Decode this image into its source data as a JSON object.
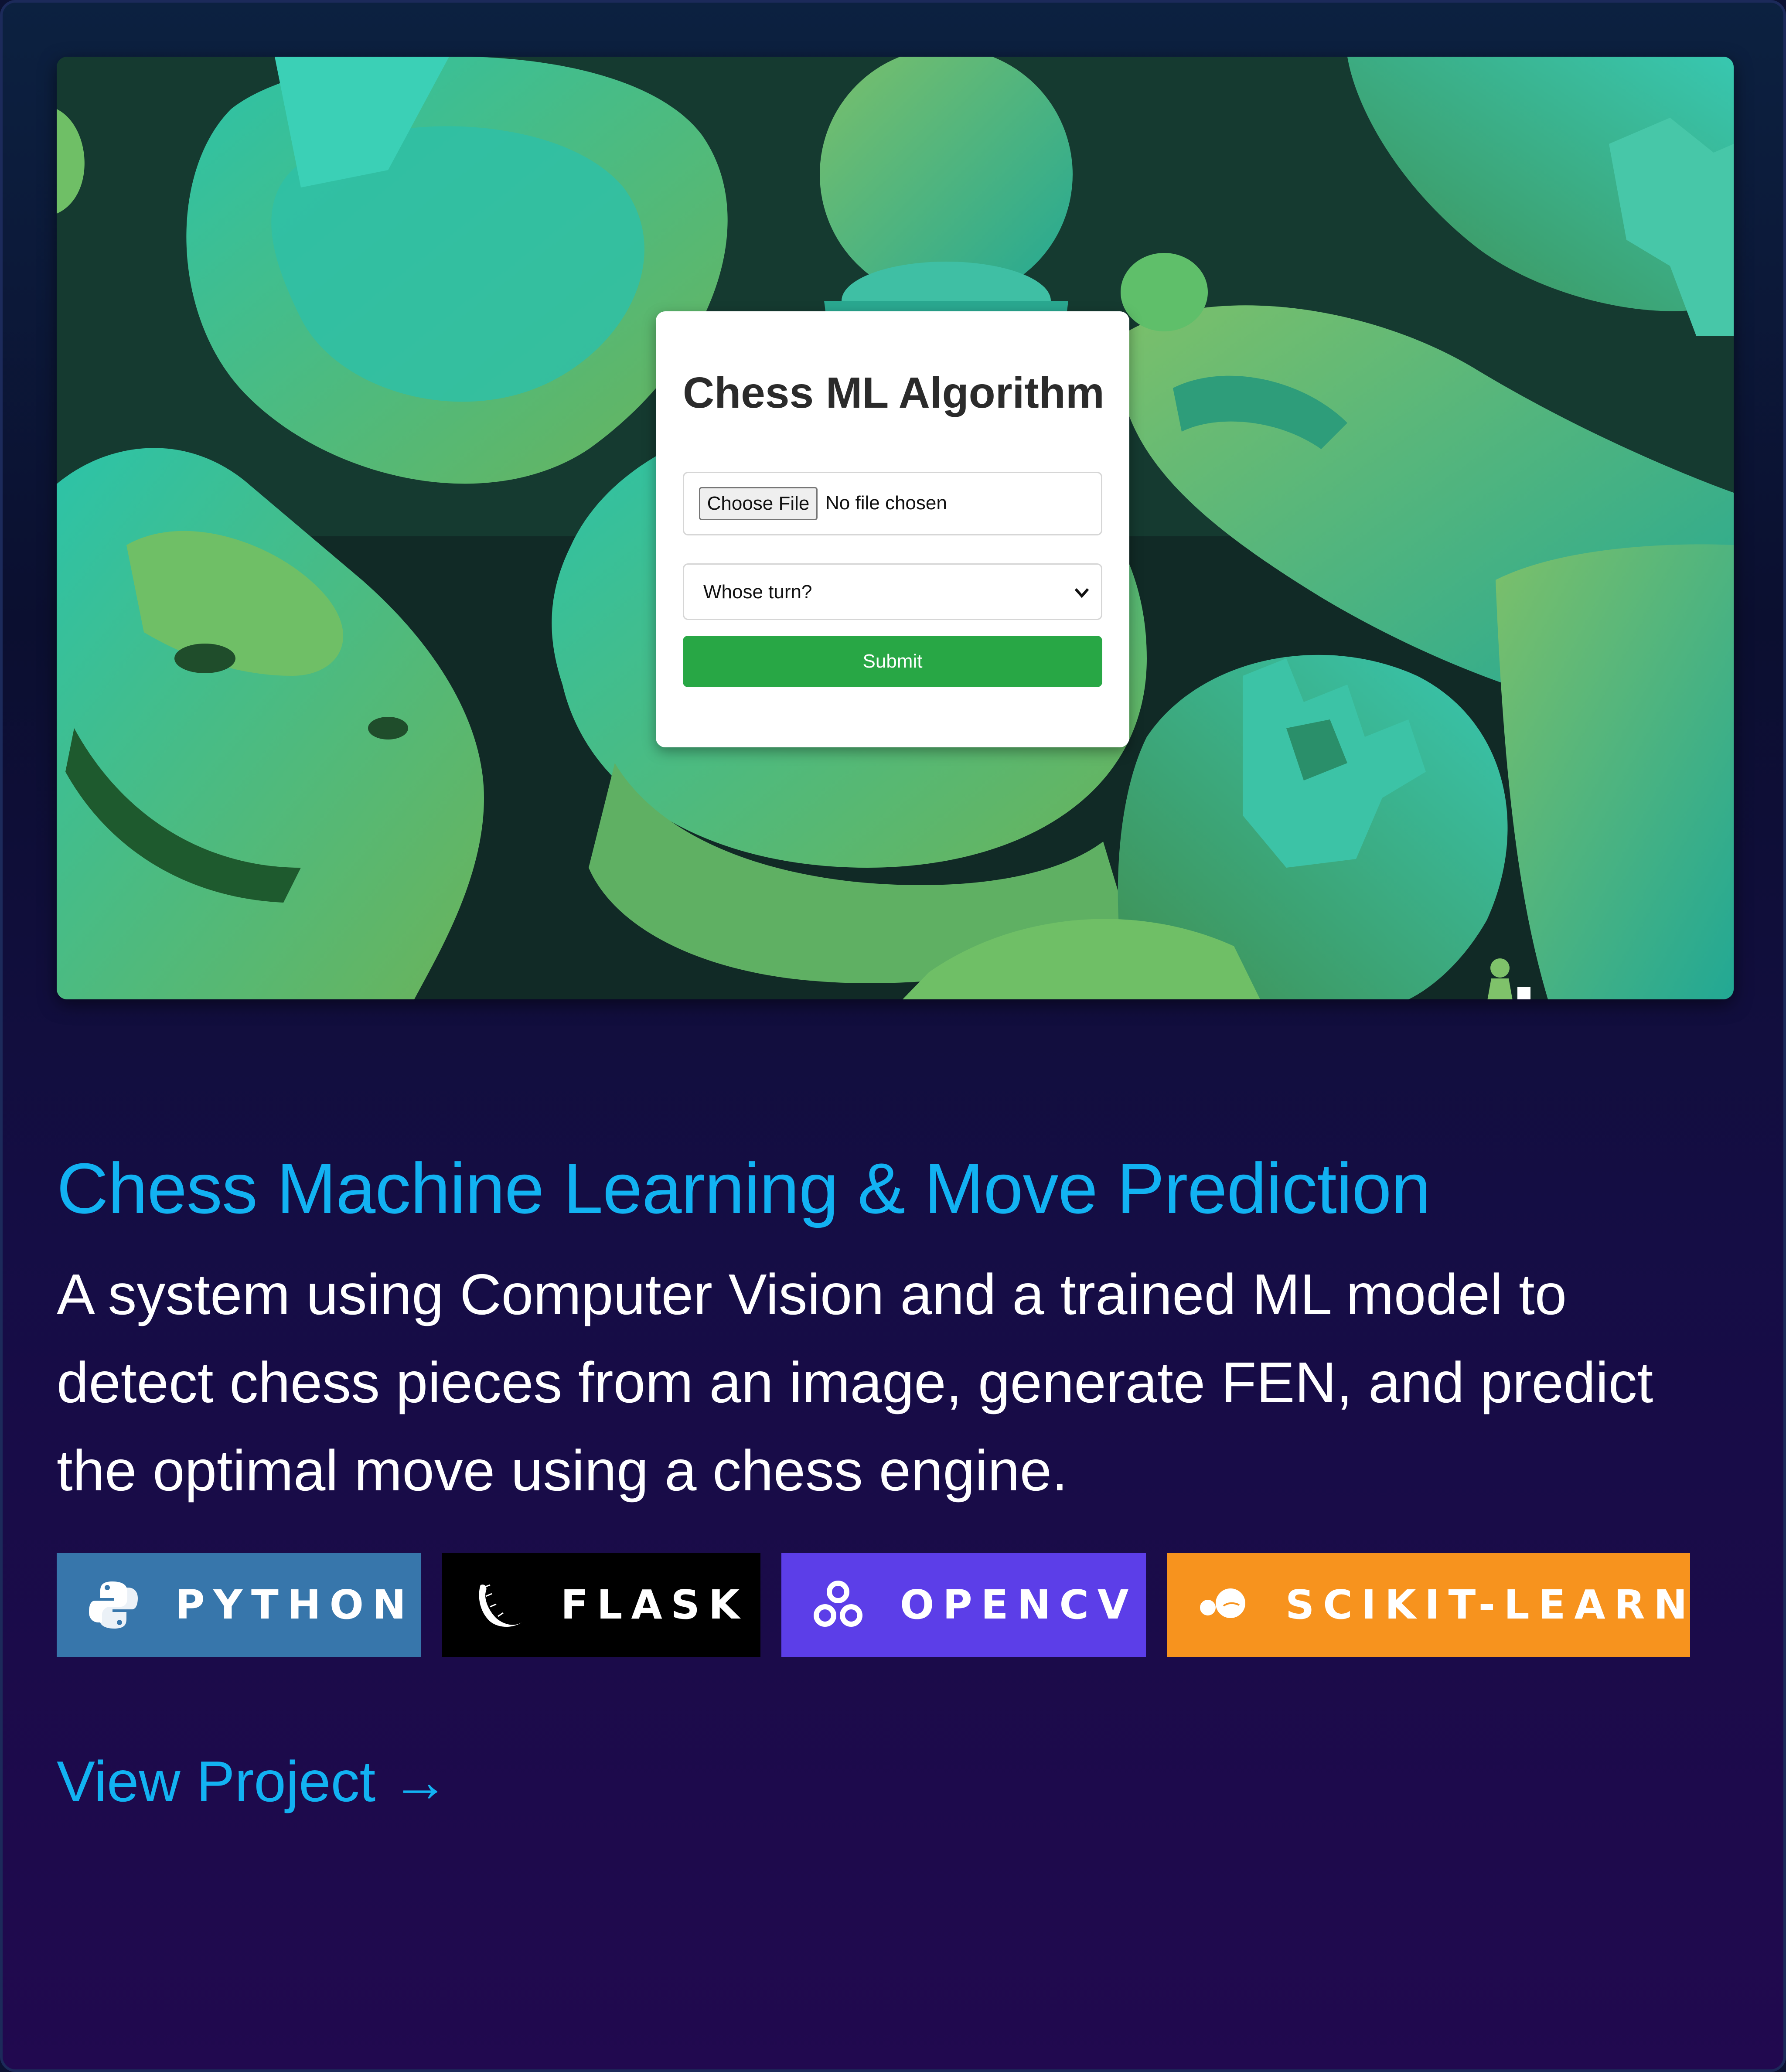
{
  "screenshot": {
    "form_title": "Chess ML Algorithm",
    "file_button_label": "Choose File",
    "file_status": "No file chosen",
    "select_value": "Whose turn?",
    "submit_label": "Submit"
  },
  "project": {
    "title": "Chess Machine Learning & Move Prediction",
    "description": "A system using Computer Vision and a trained ML model to detect chess pieces from an image, generate FEN, and predict the optimal move using a chess engine.",
    "link_label": "View Project →"
  },
  "badges": [
    {
      "label": "PYTHON",
      "icon": "python-icon",
      "color": "#3776ab"
    },
    {
      "label": "FLASK",
      "icon": "flask-icon",
      "color": "#000000"
    },
    {
      "label": "OPENCV",
      "icon": "opencv-icon",
      "color": "#5c3ee8"
    },
    {
      "label": "SCIKIT-LEARN",
      "icon": "scikit-learn-icon",
      "color": "#f7931e"
    }
  ],
  "colors": {
    "accent": "#12b2f2",
    "submit_green": "#28a745",
    "card_top": "#0c2140",
    "card_bottom": "#21094f"
  }
}
